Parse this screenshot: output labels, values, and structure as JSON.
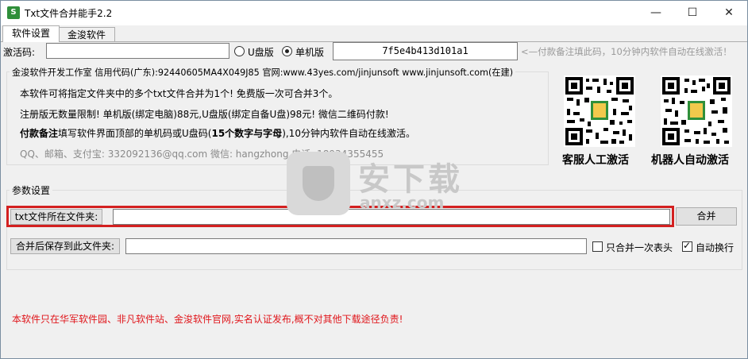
{
  "window": {
    "title": "Txt文件合并能手2.2",
    "app_icon_text": "S",
    "minimize_glyph": "—",
    "maximize_glyph": "☐",
    "close_glyph": "✕"
  },
  "tabs": [
    {
      "label": "软件设置",
      "active": true
    },
    {
      "label": "金浚软件",
      "active": false
    }
  ],
  "activation": {
    "code_label": "激活码:",
    "code_value": "",
    "radio_udisk": "U盘版",
    "radio_machine": "单机版",
    "selected": "单机版",
    "machine_code": "7f5e4b413d101a1",
    "hint": "<—付款备注填此码，10分钟内软件自动在线激活！"
  },
  "info": {
    "group_title": "金浚软件开发工作室 信用代码(广东):92440605MA4X049J85 官网:www.43yes.com/jinjunsoft  www.jinjunsoft.com(在建)",
    "line1": "本软件可将指定文件夹中的多个txt文件合并为1个! 免费版一次可合并3个。",
    "line2": "注册版无数量限制! 单机版(绑定电脑)88元,U盘版(绑定自备U盘)98元! 微信二维码付款!",
    "line3_bold": "付款备注",
    "line3_rest": "填写软件界面顶部的单机码或U盘码(",
    "line3_bold2": "15个数字与字母",
    "line3_end": "),10分钟内软件自动在线激活。",
    "line4": "QQ、邮箱、支付宝: 332092136@qq.com   微信: hangzhong   电话: 18934355455"
  },
  "qr": {
    "left_caption": "客服人工激活",
    "right_caption": "机器人自动激活",
    "badge_text": "S"
  },
  "params": {
    "group_title": "参数设置",
    "source_label": "txt文件所在文件夹:",
    "source_value": "",
    "merge_button": "合并",
    "save_label": "合并后保存到此文件夹:",
    "save_value": "",
    "only_header_once": "只合并一次表头",
    "only_header_checked": false,
    "auto_wrap": "自动换行",
    "auto_wrap_checked": true
  },
  "footer": {
    "notice": "本软件只在华军软件园、非凡软件站、金浚软件官网,实名认证发布,概不对其他下载途径负责!",
    "notice_color": "#e0161b"
  },
  "watermark": {
    "text": "安下载",
    "sub": "anxz.com"
  }
}
